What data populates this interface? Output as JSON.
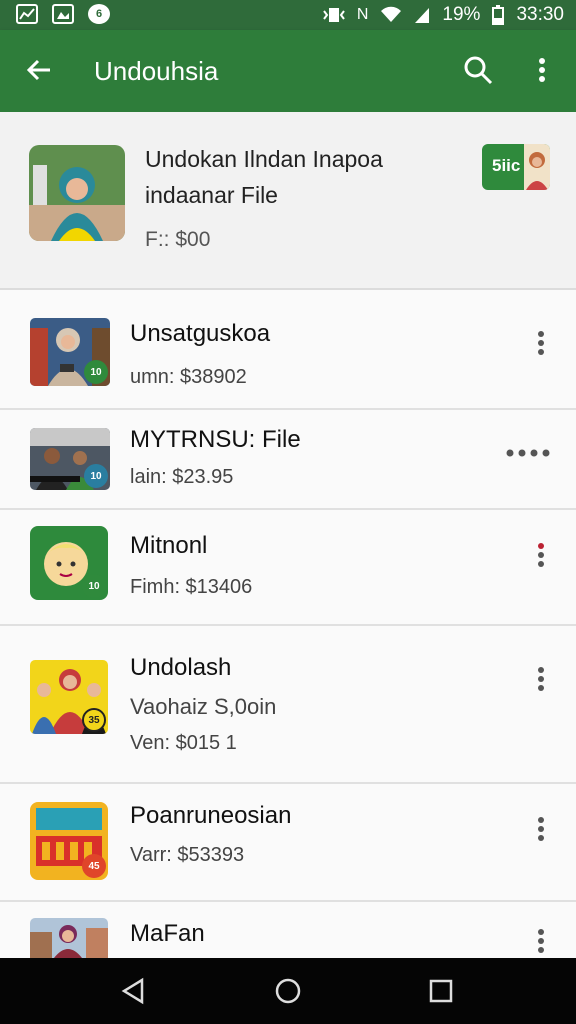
{
  "status_bar": {
    "battery": "19%",
    "time": "33:30",
    "network": "N",
    "colors": {
      "bg": "#2f6b3a"
    }
  },
  "app_bar": {
    "title": "Undouhsia",
    "back_icon": "arrow-left-icon",
    "search_icon": "search-icon",
    "more_icon": "more-vert-icon",
    "colors": {
      "bg": "#2e7d3a"
    }
  },
  "hero": {
    "title_line1": "Undokan Ilndan Inapoa",
    "title_line2": "indaanar File",
    "price": "F:: $00",
    "chip": "5iic"
  },
  "list": [
    {
      "name": "Unsatguskoa",
      "sub": "umn: $38902",
      "menu": "vertical"
    },
    {
      "name": "MYTRNSU: File",
      "sub": "lain: $23.95",
      "menu": "horizontal"
    },
    {
      "name": "Mitnonl",
      "sub": "Fimh: $13406",
      "menu": "vertical",
      "badge": "10"
    },
    {
      "name": "Undolash",
      "sub": "Vaohaiz S,0oin",
      "sub2": "Ven: $015 1",
      "menu": "vertical",
      "badge": "35"
    },
    {
      "name": "Poanruneosian",
      "sub": "Varr: $53393",
      "menu": "vertical",
      "badge": "45"
    },
    {
      "name": "MaFan",
      "menu": "vertical"
    }
  ],
  "nav_bar": {
    "icons": [
      "back-icon",
      "home-icon",
      "recents-icon"
    ]
  }
}
